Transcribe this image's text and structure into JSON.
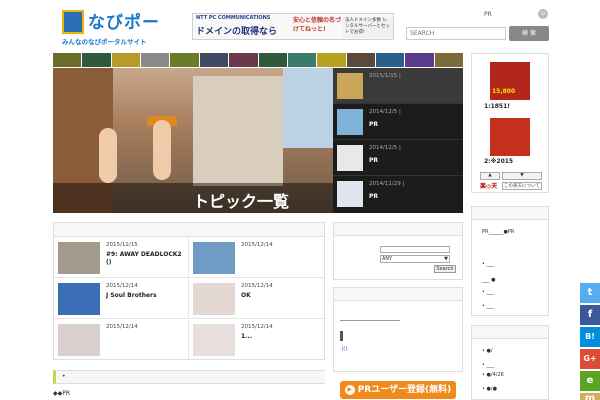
{
  "header": {
    "logo_title": "なびポー",
    "logo_sub": "みんなのなびポータルサイト",
    "banner_corp": "NTT PC COMMUNICATIONS",
    "banner_main": "ドメインの取得なら",
    "banner_mid": "安心と信頼の名づけてねっと!",
    "banner_right": "法人ドメイン多数 レンタルサーバーとセットでお得!",
    "top_link": "PR",
    "rss_icon": "rss-icon",
    "search_placeholder": "SEARCH",
    "search_button": "検 索"
  },
  "nav_colors": [
    "#6b6b2a",
    "#2f5a3b",
    "#b89a2a",
    "#8a8a8a",
    "#6a7b2a",
    "#3e4a62",
    "#6a3a4c",
    "#2f5a3b",
    "#3a7a6a",
    "#b5a31e",
    "#5b4a3a",
    "#2a5f8a",
    "#5a3a8a",
    "#7a6b3a"
  ],
  "hero": {
    "caption": "トピック一覧"
  },
  "topics": [
    {
      "date": "2015/1/15  |",
      "title": ""
    },
    {
      "date": "2014/12/5  |",
      "title": "PR"
    },
    {
      "date": "2014/12/5  |",
      "title": "PR"
    },
    {
      "date": "2014/11/29  |",
      "title": "PR"
    }
  ],
  "side_ad": {
    "label1": "1:1851!",
    "price": "15,800",
    "label2": "2:※2015",
    "btn1": "▲",
    "btn2": "▼",
    "rakuten": "楽◎天",
    "rakuten_link": "この楽天について"
  },
  "articles": [
    {
      "date": "2015/12/15",
      "title": "#9: AWAY DEADLOCK2 ()"
    },
    {
      "date": "2015/12/14",
      "title": ""
    },
    {
      "date": "2015/12/14",
      "title": "J Soul Brothers"
    },
    {
      "date": "2015/12/14",
      "title": "OK"
    },
    {
      "date": "2015/12/14",
      "title": ""
    },
    {
      "date": "2015/12/14",
      "title": "1..."
    }
  ],
  "mid_sidebar": {
    "select_value": "ANY",
    "search_button": "Search",
    "link_text": ".|().",
    "pr_button": "PRユーザー登録(無料)"
  },
  "bottom": {
    "band_label": "•",
    "pr_text": "◆◆PR"
  },
  "right_list": {
    "items": [
      "PR______●PR",
      "",
      "• ___",
      "___ ●",
      "• ___",
      "• ___"
    ]
  },
  "right_list2": {
    "items": [
      "",
      "• ●/",
      "",
      "• ___",
      "• ●/4/26",
      "• ●/●"
    ]
  },
  "social": [
    {
      "icon": "twitter-icon",
      "glyph": "t",
      "color": "#55acee"
    },
    {
      "icon": "facebook-icon",
      "glyph": "f",
      "color": "#3b5998"
    },
    {
      "icon": "hatena-icon",
      "glyph": "B!",
      "color": "#008fde"
    },
    {
      "icon": "googleplus-icon",
      "glyph": "G+",
      "color": "#dd4b39"
    },
    {
      "icon": "evernote-icon",
      "glyph": "e",
      "color": "#5ba525"
    },
    {
      "icon": "mixi-icon",
      "glyph": "m",
      "color": "#d1ad59"
    }
  ]
}
